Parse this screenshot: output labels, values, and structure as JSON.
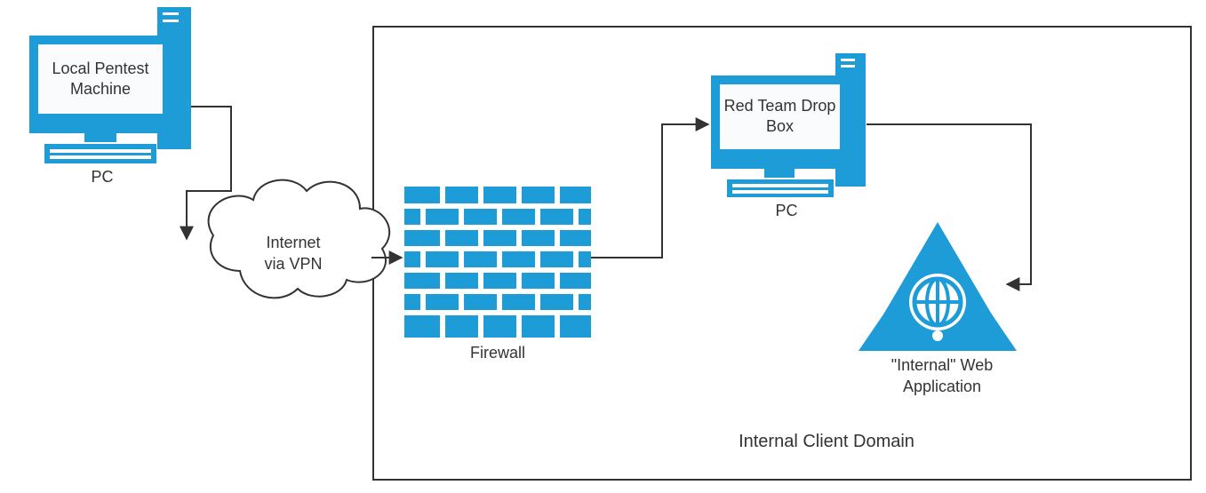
{
  "nodes": {
    "pentest_pc": {
      "label_primary": "Local Pentest Machine",
      "label_sub": "PC"
    },
    "cloud": {
      "line1": "Internet",
      "line2": "via VPN"
    },
    "firewall": {
      "label": "Firewall"
    },
    "dropbox_pc": {
      "label_primary": "Red Team Drop Box",
      "label_sub": "PC"
    },
    "webapp": {
      "line1": "\"Internal\" Web",
      "line2": "Application"
    }
  },
  "container": {
    "label": "Internal Client Domain"
  },
  "colors": {
    "brand": "#1e9cd7",
    "stroke": "#333333",
    "panel": "#f9fbfd"
  }
}
